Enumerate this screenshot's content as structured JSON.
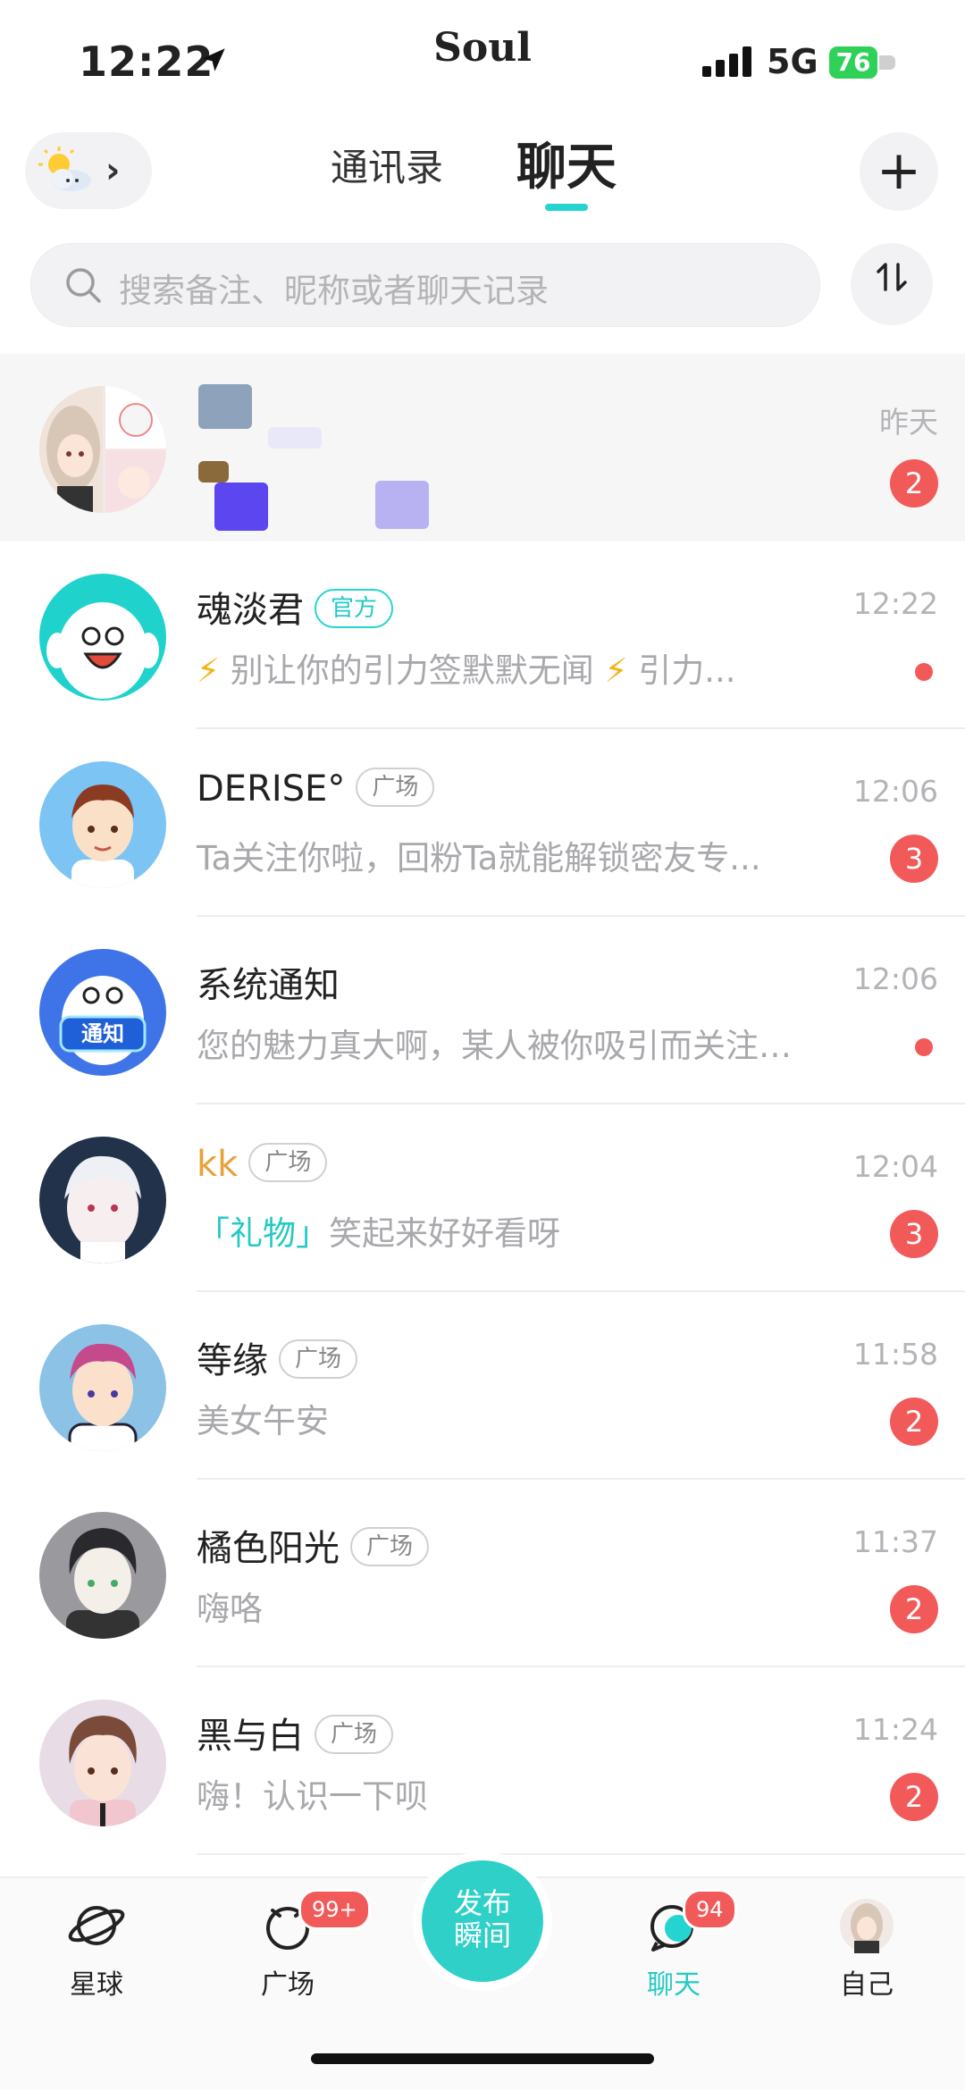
{
  "status_bar": {
    "time": "12:22",
    "app": "Soul",
    "network": "5G",
    "battery": "76"
  },
  "header": {
    "tab_contacts": "通讯录",
    "tab_chat": "聊天"
  },
  "search": {
    "placeholder": "搜索备注、昵称或者聊天记录"
  },
  "conversations": [
    {
      "name": "",
      "tag": "",
      "preview": "",
      "time": "昨天",
      "badge": "2"
    },
    {
      "name": "魂淡君",
      "tag": "官方",
      "preview_parts": [
        "⚡",
        "别让你的引力签默默无闻",
        "⚡",
        "引力..."
      ],
      "time": "12:22",
      "badge": ""
    },
    {
      "name": "DERISE°",
      "tag": "广场",
      "preview": "Ta关注你啦，回粉Ta就能解锁密友专...",
      "time": "12:06",
      "badge": "3"
    },
    {
      "name": "系统通知",
      "tag": "",
      "preview": "您的魅力真大啊，某人被你吸引而关注了...",
      "time": "12:06",
      "badge": ""
    },
    {
      "name": "kk",
      "tag": "广场",
      "preview_gift": "「礼物」",
      "preview": "笑起来好好看呀",
      "time": "12:04",
      "badge": "3"
    },
    {
      "name": "等缘",
      "tag": "广场",
      "preview": "美女午安",
      "time": "11:58",
      "badge": "2"
    },
    {
      "name": "橘色阳光",
      "tag": "广场",
      "preview": "嗨咯",
      "time": "11:37",
      "badge": "2"
    },
    {
      "name": "黑与白",
      "tag": "广场",
      "preview": "嗨！认识一下呗",
      "time": "11:24",
      "badge": "2"
    }
  ],
  "nav": {
    "planet": "星球",
    "square": "广场",
    "square_badge": "99+",
    "post_line1": "发布",
    "post_line2": "瞬间",
    "chat": "聊天",
    "chat_badge": "94",
    "me": "自己"
  },
  "colors": {
    "accent": "#25d4d0",
    "badge": "#f25a5a",
    "kk_name": "#e8a23a"
  }
}
